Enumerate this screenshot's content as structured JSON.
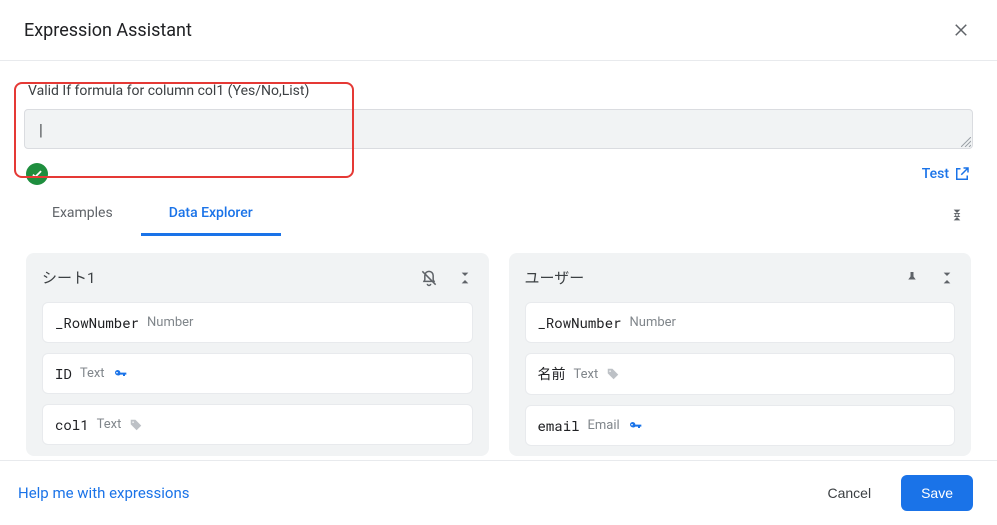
{
  "dialog": {
    "title": "Expression Assistant"
  },
  "label": "Valid If formula for column col1 (Yes/No,List)",
  "input_value": "",
  "test_label": "Test",
  "tabs": {
    "examples": "Examples",
    "data_explorer": "Data Explorer"
  },
  "panels": [
    {
      "title": "シート1",
      "columns": [
        {
          "name": "_RowNumber",
          "type": "Number",
          "icon": null
        },
        {
          "name": "ID",
          "type": "Text",
          "icon": "key"
        },
        {
          "name": "col1",
          "type": "Text",
          "icon": "tag"
        }
      ]
    },
    {
      "title": "ユーザー",
      "columns": [
        {
          "name": "_RowNumber",
          "type": "Number",
          "icon": null
        },
        {
          "name": "名前",
          "type": "Text",
          "icon": "tag"
        },
        {
          "name": "email",
          "type": "Email",
          "icon": "key"
        }
      ]
    }
  ],
  "footer": {
    "help": "Help me with expressions",
    "cancel": "Cancel",
    "save": "Save"
  }
}
